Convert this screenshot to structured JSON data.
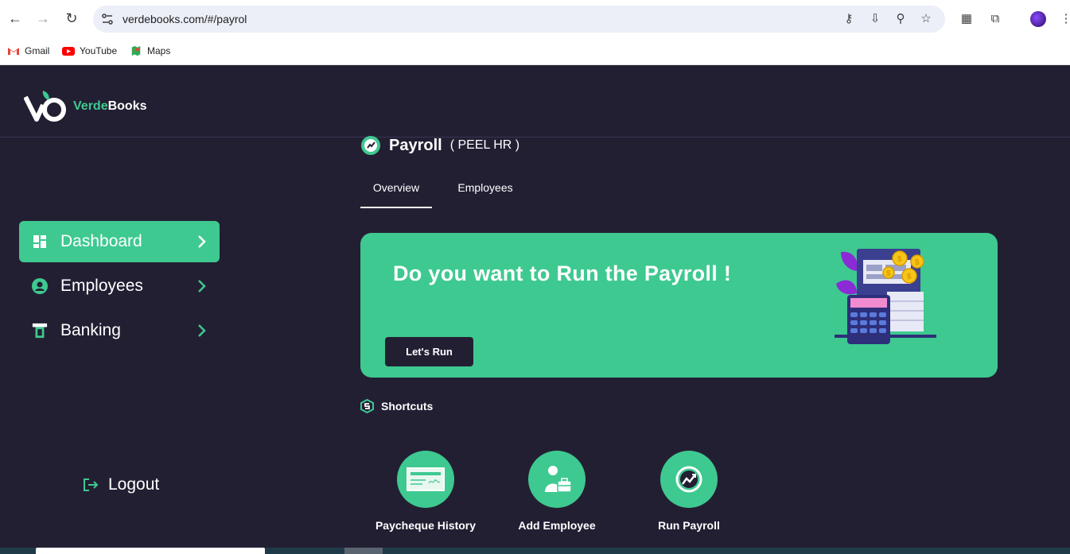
{
  "browser": {
    "url": "verdebooks.com/#/payrol",
    "bookmarks": [
      {
        "label": "Gmail",
        "icon": "gmail-icon"
      },
      {
        "label": "YouTube",
        "icon": "youtube-icon"
      },
      {
        "label": "Maps",
        "icon": "maps-icon"
      }
    ]
  },
  "brand": {
    "prefix": "Verde",
    "suffix": "Books",
    "accent": "#3ec990"
  },
  "sidebar": {
    "items": [
      {
        "label": "Dashboard",
        "icon": "dashboard-icon",
        "active": true
      },
      {
        "label": "Employees",
        "icon": "user-circle-icon",
        "active": false
      },
      {
        "label": "Banking",
        "icon": "atm-icon",
        "active": false
      }
    ],
    "logout": "Logout"
  },
  "page": {
    "title": "Payroll",
    "subtitle": "( PEEL HR )",
    "tabs": [
      {
        "label": "Overview",
        "active": true
      },
      {
        "label": "Employees",
        "active": false
      }
    ]
  },
  "banner": {
    "headline": "Do you want to Run the Payroll !",
    "button": "Let's Run"
  },
  "shortcuts": {
    "title": "Shortcuts",
    "items": [
      {
        "label": "Paycheque History",
        "icon": "cheque-icon"
      },
      {
        "label": "Add Employee",
        "icon": "add-employee-icon"
      },
      {
        "label": "Run Payroll",
        "icon": "run-payroll-icon"
      }
    ]
  },
  "colors": {
    "background": "#231f33",
    "accent": "#3ec990",
    "text": "#ffffff"
  }
}
